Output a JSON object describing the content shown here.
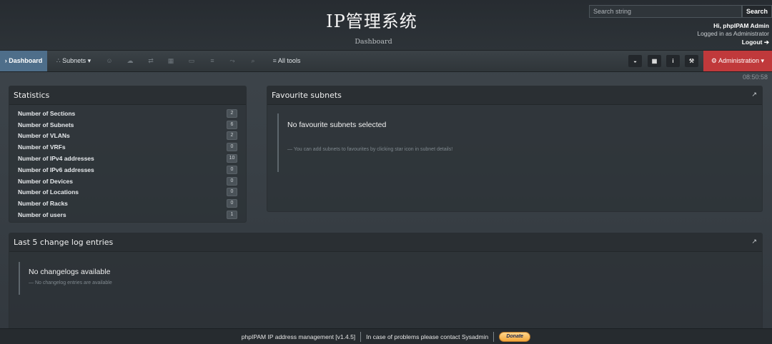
{
  "header": {
    "title": "IP管理系统",
    "subtitle": "Dashboard",
    "search_placeholder": "Search string",
    "search_button": "Search",
    "greeting": "Hi, phpIPAM Admin",
    "logged_in_as": "Logged in as  Administrator",
    "logout": "Logout"
  },
  "nav": {
    "dashboard": "› Dashboard",
    "subnets": "Subnets ▾",
    "all_tools": "All tools",
    "administration": "Administration ▾",
    "icons": [
      "users-icon",
      "cloud-icon",
      "exchange-icon",
      "map-icon",
      "monitor-icon",
      "list-icon",
      "random-icon",
      "search-icon"
    ],
    "right_icons": [
      "dashboard-icon",
      "grid-icon",
      "info-icon",
      "wrench-icon"
    ]
  },
  "clock": "08:50:58",
  "statistics": {
    "title": "Statistics",
    "rows": [
      {
        "label": "Number of Sections",
        "value": "2"
      },
      {
        "label": "Number of Subnets",
        "value": "6"
      },
      {
        "label": "Number of VLANs",
        "value": "2"
      },
      {
        "label": "Number of VRFs",
        "value": "0"
      },
      {
        "label": "Number of IPv4 addresses",
        "value": "10"
      },
      {
        "label": "Number of IPv6 addresses",
        "value": "0"
      },
      {
        "label": "Number of Devices",
        "value": "0"
      },
      {
        "label": "Number of Locations",
        "value": "0"
      },
      {
        "label": "Number of Racks",
        "value": "0"
      },
      {
        "label": "Number of users",
        "value": "1"
      }
    ]
  },
  "favourites": {
    "title": "Favourite subnets",
    "empty_title": "No favourite subnets selected",
    "empty_hint": "— You can add subnets to favourites by clicking star icon in subnet details!"
  },
  "changelog": {
    "title": "Last 5 change log entries",
    "empty_title": "No changelogs available",
    "empty_hint": "— No changelog entries are available"
  },
  "footer": {
    "app": "phpIPAM IP address management [v1.4.5]",
    "contact": "In case of problems please contact Sysadmin",
    "donate": "Donate"
  },
  "colors": {
    "accent": "#4e6e8a",
    "admin": "#c0393b"
  }
}
